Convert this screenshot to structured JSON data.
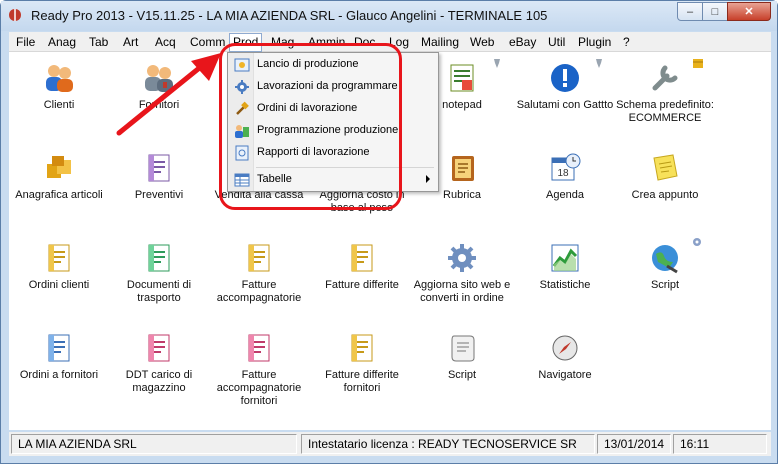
{
  "window": {
    "title": "Ready Pro 2013 - V15.11.25 - LA MIA AZIENDA SRL - Glauco Angelini - TERMINALE 105",
    "minimize": "–",
    "maximize": "□",
    "close": "✕"
  },
  "menu": [
    "File",
    "Anag",
    "Tab",
    "Art",
    "Acq",
    "Comm",
    "Prod",
    "Mag",
    "Ammin",
    "Doc",
    "Log",
    "Mailing",
    "Web",
    "eBay",
    "Util",
    "Plugin",
    "?"
  ],
  "dropdown": {
    "items": [
      "Lancio di produzione",
      "Lavorazioni da programmare",
      "Ordini di lavorazione",
      "Programmazione produzione",
      "Rapporti di lavorazione"
    ],
    "submenu": "Tabelle"
  },
  "tiles": [
    {
      "label": "Clienti",
      "icon": "clients-icon"
    },
    {
      "label": "Fornitori",
      "icon": "suppliers-icon"
    },
    {
      "label": "notepad",
      "icon": "notepad-icon"
    },
    {
      "label": "Salutami con Gattto",
      "icon": "info-icon"
    },
    {
      "label": "Schema predefinito: ECOMMERCE",
      "icon": "wrench-icon"
    },
    {
      "label": "Anagrafica articoli",
      "icon": "boxes-icon"
    },
    {
      "label": "Preventivi",
      "icon": "document-icon"
    },
    {
      "label": "Vendita alla cassa",
      "icon": "register-icon"
    },
    {
      "label": "Aggiorna costo in base al peso",
      "icon": "weight-icon"
    },
    {
      "label": "Rubrica",
      "icon": "addressbook-icon"
    },
    {
      "label": "Agenda",
      "icon": "calendar-clock-icon"
    },
    {
      "label": "Crea appunto",
      "icon": "sticky-note-icon"
    },
    {
      "label": "Ordini clienti",
      "icon": "document-icon"
    },
    {
      "label": "Documenti di trasporto",
      "icon": "document-icon"
    },
    {
      "label": "Fatture accompagnatorie",
      "icon": "document-icon"
    },
    {
      "label": "Fatture differite",
      "icon": "document-icon"
    },
    {
      "label": "Aggiorna sito web e converti in ordine",
      "icon": "gear-icon"
    },
    {
      "label": "Statistiche",
      "icon": "chart-icon"
    },
    {
      "label": "Script",
      "icon": "globe-icon"
    },
    {
      "label": "Ordini a fornitori",
      "icon": "document-icon"
    },
    {
      "label": "DDT carico di magazzino",
      "icon": "document-icon"
    },
    {
      "label": "Fatture accompagnatorie fornitori",
      "icon": "document-icon"
    },
    {
      "label": "Fatture differite fornitori",
      "icon": "document-icon"
    },
    {
      "label": "Script",
      "icon": "scroll-icon"
    },
    {
      "label": "Navigatore",
      "icon": "compass-icon"
    }
  ],
  "status": {
    "company": "LA MIA AZIENDA SRL",
    "license": "Intestatario licenza : READY TECNOSERVICE SR",
    "date": "13/01/2014",
    "time": "16:11"
  },
  "colors": {
    "highlight": "#e8151b",
    "arrow": "#e8151b"
  }
}
